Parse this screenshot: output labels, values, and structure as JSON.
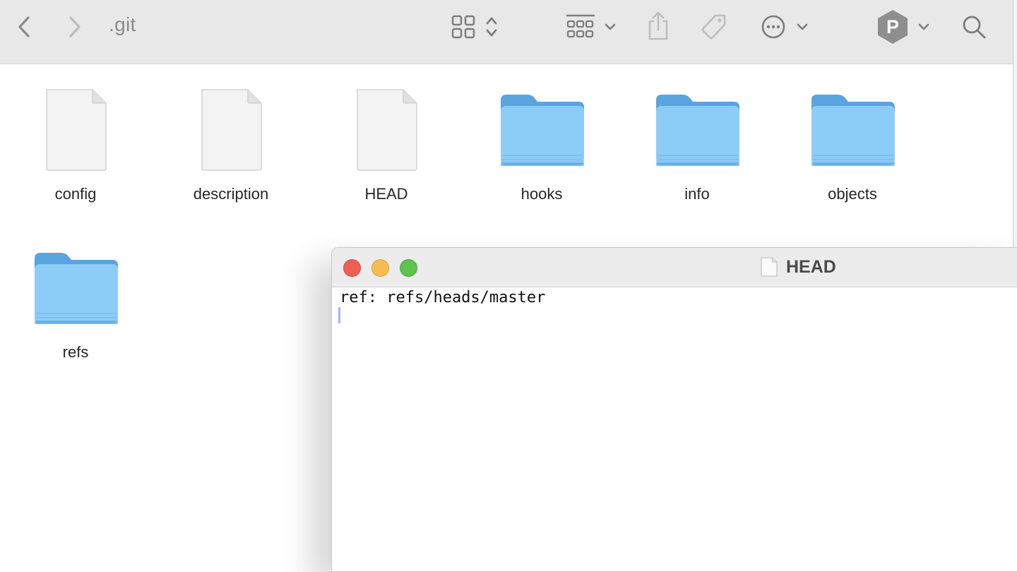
{
  "toolbar": {
    "folder_title": ".git",
    "icons": [
      "back-icon",
      "forward-icon",
      "view-grid-icon",
      "view-sort-icon",
      "group-icon",
      "share-icon",
      "tag-icon",
      "more-icon",
      "user-avatar-icon",
      "search-icon"
    ],
    "avatar_letter": "P"
  },
  "files": [
    {
      "name": "config",
      "kind": "document"
    },
    {
      "name": "description",
      "kind": "document"
    },
    {
      "name": "HEAD",
      "kind": "document"
    },
    {
      "name": "hooks",
      "kind": "folder"
    },
    {
      "name": "info",
      "kind": "folder"
    },
    {
      "name": "objects",
      "kind": "folder"
    },
    {
      "name": "refs",
      "kind": "folder"
    }
  ],
  "editor": {
    "title": "HEAD",
    "content_line": "ref: refs/heads/master"
  },
  "colors": {
    "folder_body": "#8ccdf7",
    "folder_tab": "#5aa4df",
    "close": "#ee5f57",
    "minimize": "#f4bd4f",
    "zoom": "#5ec34f"
  }
}
